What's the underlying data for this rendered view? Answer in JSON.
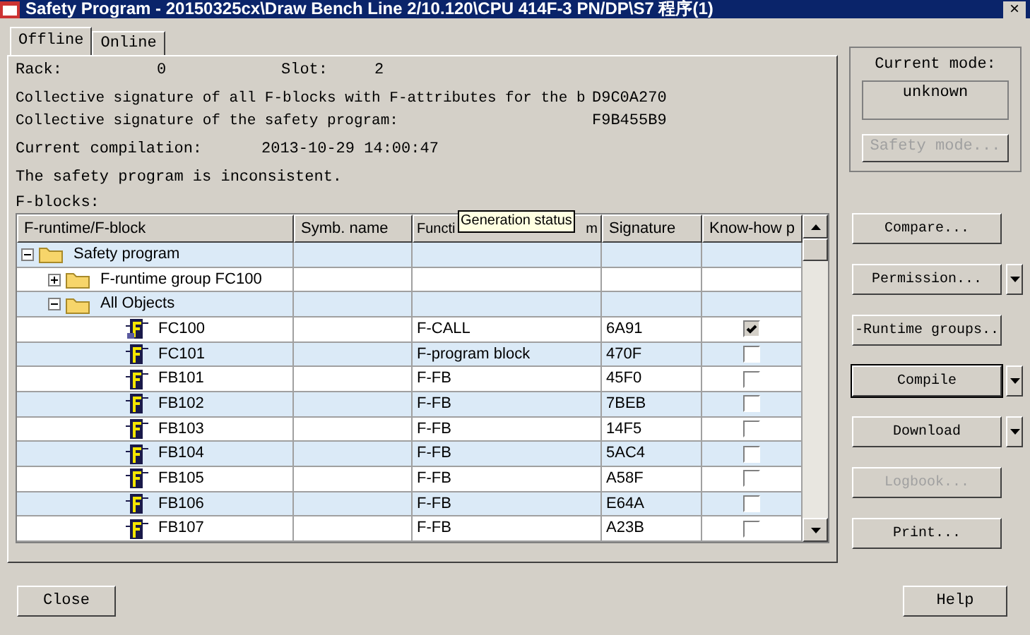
{
  "window": {
    "title": "Safety Program - 20150325cx\\Draw Bench Line 2/10.120\\CPU 414F-3 PN/DP\\S7 程序(1)",
    "close": "×"
  },
  "tabs": [
    {
      "label": "Offline",
      "selected": true
    },
    {
      "label": "Online",
      "selected": false
    }
  ],
  "info": {
    "rack_label": "Rack:",
    "rack": "0",
    "slot_label": "Slot:",
    "slot": "2",
    "sig_all_label": "Collective signature of all F-blocks with F-attributes for the b",
    "sig_all": "D9C0A270",
    "sig_prog_label": "Collective signature of the safety program:",
    "sig_prog": "F9B455B9",
    "compile_label": "Current compilation:",
    "compile": "2013-10-29 14:00:47",
    "status": "The safety program is inconsistent.",
    "fblocks_label": "F-blocks:"
  },
  "table": {
    "columns": [
      "F-runtime/F-block",
      "Symb. name",
      "Functi",
      "Signature",
      "Know-how p"
    ],
    "column_3_end": "m",
    "tooltip": "Generation status",
    "rows": [
      {
        "kind": "folder",
        "name": "Safety program",
        "expanded": true,
        "children": [
          {
            "kind": "folder",
            "name": "F-runtime group FC100",
            "expanded": false
          },
          {
            "kind": "folder",
            "name": "All Objects",
            "expanded": true,
            "children": [
              {
                "kind": "block",
                "name": "FC100",
                "function": "F-CALL",
                "signature": "6A91",
                "checked": true
              },
              {
                "kind": "block",
                "name": "FC101",
                "function": "F-program block",
                "signature": "470F",
                "checked": false
              },
              {
                "kind": "block",
                "name": "FB101",
                "function": "F-FB",
                "signature": "45F0",
                "checked": false
              },
              {
                "kind": "block",
                "name": "FB102",
                "function": "F-FB",
                "signature": "7BEB",
                "checked": false
              },
              {
                "kind": "block",
                "name": "FB103",
                "function": "F-FB",
                "signature": "14F5",
                "checked": false
              },
              {
                "kind": "block",
                "name": "FB104",
                "function": "F-FB",
                "signature": "5AC4",
                "checked": false
              },
              {
                "kind": "block",
                "name": "FB105",
                "function": "F-FB",
                "signature": "A58F",
                "checked": false
              },
              {
                "kind": "block",
                "name": "FB106",
                "function": "F-FB",
                "signature": "E64A",
                "checked": false
              },
              {
                "kind": "block",
                "name": "FB107",
                "function": "F-FB",
                "signature": "A23B",
                "checked": false
              }
            ]
          }
        ]
      }
    ]
  },
  "mode": {
    "label": "Current mode:",
    "value": "unknown",
    "button": {
      "label": "Safety mode...",
      "disabled": true
    }
  },
  "buttons": [
    {
      "label": "Compare...",
      "dropdown": false,
      "disabled": false,
      "focused": false
    },
    {
      "label": "Permission...",
      "dropdown": true,
      "disabled": false,
      "focused": false
    },
    {
      "label": "-Runtime groups..",
      "dropdown": false,
      "disabled": false,
      "focused": false
    },
    {
      "label": "Compile",
      "dropdown": true,
      "disabled": false,
      "focused": true
    },
    {
      "label": "Download",
      "dropdown": true,
      "disabled": false,
      "focused": false
    },
    {
      "label": "Logbook...",
      "dropdown": false,
      "disabled": true,
      "focused": false
    },
    {
      "label": "Print...",
      "dropdown": false,
      "disabled": false,
      "focused": false
    }
  ],
  "footer": [
    "Close",
    "Help"
  ]
}
